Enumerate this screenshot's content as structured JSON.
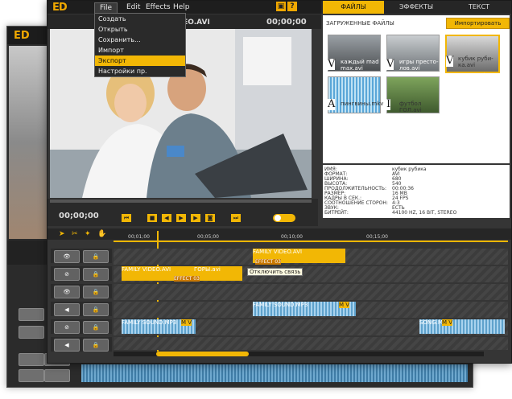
{
  "colors": {
    "accent": "#f2b705",
    "panel": "#353535"
  },
  "app": {
    "logo": "ED"
  },
  "menu": {
    "file": "File",
    "edit": "Edit",
    "effects": "Effects",
    "help": "Help",
    "dropdown": [
      "Создать",
      "Открыть",
      "Сохранить...",
      "Импорт",
      "Экспорт",
      "Настройки пр."
    ],
    "highlighted": "Экспорт"
  },
  "player": {
    "title": "FAMILY VIDEO.AVI",
    "time_top": "00;00;00",
    "time_bottom": "00;00;00"
  },
  "tabs": [
    "ФАЙЛЫ",
    "ЭФФЕКТЫ",
    "ТЕКСТ"
  ],
  "library": {
    "header": "ЗАГРУЖЕННЫЕ ФАЙЛЫ",
    "import_button": "Импортировать",
    "thumbs": [
      {
        "letter": "V",
        "label": "каждый mad max.avi"
      },
      {
        "letter": "V",
        "label": "игры престо- лов.avi"
      },
      {
        "letter": "V",
        "label": "кубик руби- ка.avi"
      },
      {
        "letter": "A",
        "label": "пингвины.mkv"
      },
      {
        "letter": "I",
        "label": "футбол ГОЛ.avi"
      }
    ]
  },
  "properties": [
    {
      "k": "ИМЯ:",
      "v": "кубик рубика"
    },
    {
      "k": "ФОРМАТ:",
      "v": "AVI"
    },
    {
      "k": "ШИРИНА:",
      "v": "680"
    },
    {
      "k": "ВЫСОТА:",
      "v": "540"
    },
    {
      "k": "ПРОДОЛЖИТЕЛЬНОСТЬ:",
      "v": "00:00:36"
    },
    {
      "k": "РАЗМЕР:",
      "v": "16 MB"
    },
    {
      "k": "КАДРЫ В СЕК.:",
      "v": "24 FPS"
    },
    {
      "k": "СООТНОШЕНИЕ СТОРОН:",
      "v": "4:3"
    },
    {
      "k": "ЗВУК:",
      "v": "ЕСТЬ"
    },
    {
      "k": "БИТРЕЙТ:",
      "v": "44100 HZ, 16 BIT, STEREO"
    }
  ],
  "timeline": {
    "ticks": [
      "00;01;00",
      "00;05;00",
      "00;10;00",
      "00;15;00"
    ],
    "v_label": "V",
    "a_label": "A",
    "clips": {
      "video1": "FAMILY VIDEO.AVI",
      "video2": "FAMILY VIDEO.AVI",
      "video3": "ГОРЫ.avi",
      "effect1": "EFFECT 03",
      "effect2": "EFFECT 03",
      "audio1": "FAMILY SOUND.MP3",
      "audio2": "FAMILY SOUND.MP3",
      "audio3": "SONG.MP3"
    },
    "tooltip": "Отключить связь",
    "mv": "M V"
  }
}
